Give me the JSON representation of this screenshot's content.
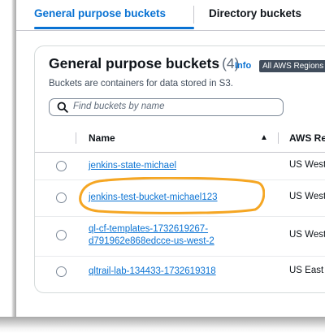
{
  "tabs": [
    {
      "label": "General purpose buckets",
      "selected": true
    },
    {
      "label": "Directory buckets",
      "selected": false
    }
  ],
  "card": {
    "title": "General purpose buckets",
    "count": "(4)",
    "info_label": "Info",
    "regions_badge": "All AWS Regions",
    "description": "Buckets are containers for data stored in S3."
  },
  "search": {
    "placeholder": "Find buckets by name"
  },
  "table": {
    "columns": {
      "name": "Name",
      "region": "AWS Re"
    },
    "rows": [
      {
        "name": "jenkins-state-michael",
        "region": "US West"
      },
      {
        "name": "jenkins-test-bucket-michael123",
        "region": "US West"
      },
      {
        "name_line1": "ql-cf-templates-1732619267-",
        "name_line2": "d791962e868edcce-us-west-2",
        "region": "US West"
      },
      {
        "name": "qltrail-lab-134433-1732619318",
        "region": "US East"
      }
    ]
  },
  "colors": {
    "link": "#0972d3",
    "highlight": "#f5a623"
  },
  "icons": {
    "search": "search-icon",
    "sort": "sort-ascending-icon",
    "radio": "radio-button-icon"
  }
}
